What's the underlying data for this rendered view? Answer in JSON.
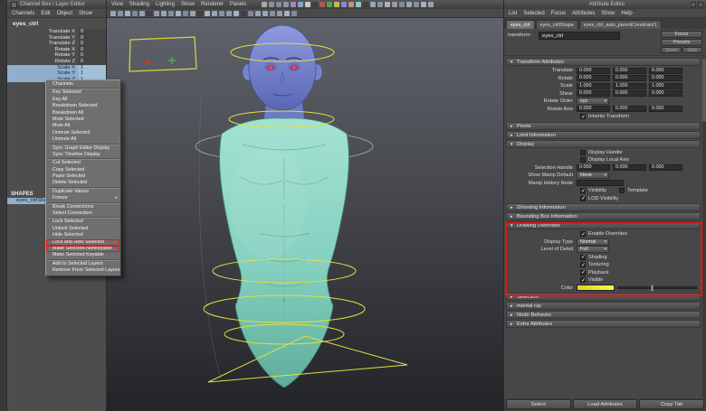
{
  "colors": {
    "selection_blue": "#8fafcd",
    "annotation_red": "#e31616",
    "body_teal": "#85d6c5",
    "head_blue": "#7584cc",
    "control_yellow": "#e0e040",
    "override_swatch_yellow": "#f0ee30"
  },
  "channel_box": {
    "title": "Channel Box / Layer Editor",
    "menus": [
      "Channels",
      "Edit",
      "Object",
      "Show"
    ],
    "node_name": "eyes_ctrl",
    "attributes": [
      {
        "label": "Translate X",
        "value": "0",
        "selected": false
      },
      {
        "label": "Translate Y",
        "value": "0",
        "selected": false
      },
      {
        "label": "Translate Z",
        "value": "0",
        "selected": false
      },
      {
        "label": "Rotate X",
        "value": "0",
        "selected": false
      },
      {
        "label": "Rotate Y",
        "value": "0",
        "selected": false
      },
      {
        "label": "Rotate Z",
        "value": "0",
        "selected": false
      },
      {
        "label": "Scale X",
        "value": "1",
        "selected": true
      },
      {
        "label": "Scale Y",
        "value": "1",
        "selected": true
      },
      {
        "label": "Scale Z",
        "value": "1",
        "selected": true
      }
    ],
    "shapes_heading": "SHAPES",
    "shape_node": "eyes_ctrlShape",
    "shape_node_selected": true
  },
  "context_menu": {
    "items": [
      {
        "label": "Channels"
      },
      {
        "label": "Key Selected"
      },
      {
        "label": "Key All"
      },
      {
        "label": "Breakdown Selected"
      },
      {
        "label": "Breakdown All"
      },
      {
        "label": "Mute Selected"
      },
      {
        "label": "Mute All"
      },
      {
        "label": "Unmute Selected"
      },
      {
        "label": "Unmute All"
      },
      {
        "label": "Sync Graph Editor Display"
      },
      {
        "label": "Sync Timeline Display"
      },
      {
        "label": "Cut Selected"
      },
      {
        "label": "Copy Selected"
      },
      {
        "label": "Paste Selected"
      },
      {
        "label": "Delete Selected"
      },
      {
        "label": "Duplicate Values"
      },
      {
        "label": "Freeze",
        "has_submenu": true
      },
      {
        "label": "Break Connections"
      },
      {
        "label": "Select Connection"
      },
      {
        "label": "Lock Selected"
      },
      {
        "label": "Unlock Selected"
      },
      {
        "label": "Hide Selected"
      },
      {
        "label": "Lock and Hide Selected",
        "annotated": true
      },
      {
        "label": "Make Selected Nonkeyable",
        "annotated": true
      },
      {
        "label": "Make Selected Keyable"
      },
      {
        "label": "Add to Selected Layers"
      },
      {
        "label": "Remove From Selected Layers"
      }
    ]
  },
  "viewport": {
    "menus": [
      "View",
      "Shading",
      "Lighting",
      "Show",
      "Renderer",
      "Panels"
    ]
  },
  "toolbars": {
    "status_line_icons": [
      "#a8a8a8",
      "#8f8f8f",
      "#7c8ca2",
      "#8796ac",
      "#a886b0",
      "#86a5c8",
      "#c9c9c9",
      "#3f3f3f",
      "#b05858",
      "#58a058",
      "#c8b858",
      "#8a8ad0",
      "#d08a8a",
      "#8ac8c8",
      "#3f3f3f",
      "#9aa4b4",
      "#8792a6",
      "#b0b0b0",
      "#8f9bb0",
      "#7d8aa0",
      "#98a4b8",
      "#8590a4",
      "#a8b0c0",
      "#9aa2b0"
    ],
    "viewport_icons": [
      "#98a4b8",
      "#8590a4",
      "#a8b0c0",
      "#7d8aa0",
      "#9aa2b0",
      "#3f3f3f",
      "#8f9bb0",
      "#98a4b8",
      "#8590a4",
      "#a8b0c0",
      "#7d8aa0",
      "#9aa2b0",
      "#3f3f3f",
      "#aab2c0",
      "#98a4b8",
      "#8590a4",
      "#8f9bb0",
      "#a8b0c0",
      "#3f3f3f",
      "#7d8aa0",
      "#9aa2b0",
      "#98a4b8",
      "#8590a4",
      "#8f9bb0",
      "#a8b0c0",
      "#7d8aa0"
    ]
  },
  "attribute_editor": {
    "title": "Attribute Editor",
    "menus": [
      "List",
      "Selected",
      "Focus",
      "Attributes",
      "Show",
      "Help"
    ],
    "tabs": [
      {
        "label": "eyes_ctrl",
        "active": true
      },
      {
        "label": "eyes_ctrlShape",
        "active": false
      },
      {
        "label": "eyes_ctrl_auto_parentConstraint1",
        "active": false
      }
    ],
    "node_type_label": "transform:",
    "node_name": "eyes_ctrl",
    "focus_button": "Focus",
    "presets_button": "Presets",
    "show_button": "Show",
    "hide_button": "Hide",
    "sections": {
      "transform_attributes": {
        "label": "Transform Attributes",
        "expanded": true
      },
      "pivots": {
        "label": "Pivots",
        "expanded": false
      },
      "limit_information": {
        "label": "Limit Information",
        "expanded": false
      },
      "display": {
        "label": "Display",
        "expanded": true
      },
      "ghosting_information": {
        "label": "Ghosting Information",
        "expanded": false
      },
      "bounding_box_information": {
        "label": "Bounding Box Information",
        "expanded": false
      },
      "drawing_overrides": {
        "label": "Drawing Overrides",
        "expanded": true
      },
      "selection": {
        "label": "Selection",
        "expanded": false
      },
      "mental_ray": {
        "label": "mental ray",
        "expanded": false
      },
      "node_behavior": {
        "label": "Node Behavior",
        "expanded": false
      },
      "extra_attributes": {
        "label": "Extra Attributes",
        "expanded": false
      }
    },
    "transform_attributes": {
      "rows": [
        {
          "label": "Translate",
          "values": [
            "0.000",
            "0.000",
            "0.000"
          ]
        },
        {
          "label": "Rotate",
          "values": [
            "0.000",
            "0.000",
            "0.000"
          ]
        },
        {
          "label": "Scale",
          "values": [
            "1.000",
            "1.000",
            "1.000"
          ]
        },
        {
          "label": "Shear",
          "values": [
            "0.000",
            "0.000",
            "0.000"
          ]
        }
      ],
      "rotate_order": {
        "label": "Rotate Order",
        "value": "xyz"
      },
      "rotate_axis": {
        "label": "Rotate Axis",
        "values": [
          "0.000",
          "0.000",
          "0.000"
        ]
      },
      "inherits_transform": {
        "label": "Inherits Transform",
        "checked": true
      }
    },
    "display": {
      "display_handle": {
        "label": "Display Handle",
        "checked": false
      },
      "display_local_axis": {
        "label": "Display Local Axis",
        "checked": false
      },
      "selection_handle": {
        "label": "Selection Handle",
        "values": [
          "0.000",
          "0.000",
          "0.000"
        ]
      },
      "show_manip_default": {
        "label": "Show Manip Default",
        "value": "None"
      },
      "manip_history_node": {
        "label": "Manip History Node",
        "value": ""
      },
      "visibility": {
        "label": "Visibility",
        "checked": true
      },
      "template": {
        "label": "Template",
        "checked": false
      },
      "lod_visibility": {
        "label": "LOD Visibility",
        "checked": true
      }
    },
    "drawing_overrides": {
      "enable_overrides": {
        "label": "Enable Overrides",
        "checked": true
      },
      "display_type": {
        "label": "Display Type",
        "value": "Normal"
      },
      "level_of_detail": {
        "label": "Level of Detail",
        "value": "Full"
      },
      "shading": {
        "label": "Shading",
        "checked": true
      },
      "texturing": {
        "label": "Texturing",
        "checked": true
      },
      "playback": {
        "label": "Playback",
        "checked": true
      },
      "visible": {
        "label": "Visible",
        "checked": true
      },
      "color": {
        "label": "Color"
      }
    },
    "bottom_buttons": [
      "Select",
      "Load Attributes",
      "Copy Tab"
    ]
  }
}
